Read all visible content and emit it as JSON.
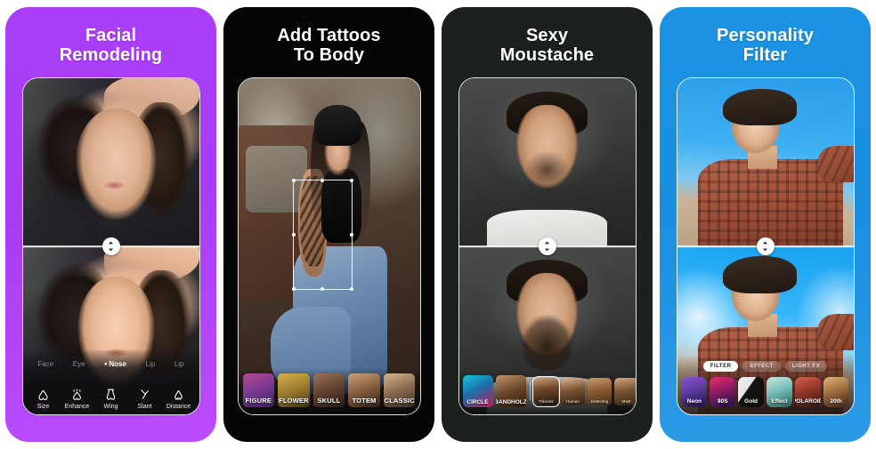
{
  "app_store_gallery": {
    "panels": [
      {
        "id": "facial-remodeling",
        "title": "Facial\nRemodeling",
        "background_color": "#a93cf8",
        "comparison_handle": "vertical-drag-handle",
        "tabs": [
          {
            "label": "Face",
            "selected": false
          },
          {
            "label": "Eye",
            "selected": false
          },
          {
            "label": "Nose",
            "selected": true
          },
          {
            "label": "Lip",
            "selected": false
          },
          {
            "label": "Lip",
            "selected": false
          }
        ],
        "tools": [
          {
            "label": "Size",
            "icon": "nose-size-icon"
          },
          {
            "label": "Enhance",
            "icon": "nose-enhance-icon"
          },
          {
            "label": "Wing",
            "icon": "nose-wing-icon"
          },
          {
            "label": "Slant",
            "icon": "nose-slant-icon"
          },
          {
            "label": "Distance",
            "icon": "nose-distance-icon"
          }
        ]
      },
      {
        "id": "add-tattoos",
        "title": "Add Tattoos\nTo Body",
        "background_color": "#050505",
        "selection_box": "tattoo-placement-box",
        "thumbnails": [
          {
            "label": "FIGURE",
            "colors": [
              "#b44a8e",
              "#5d3f8e"
            ]
          },
          {
            "label": "FLOWER",
            "colors": [
              "#c8a23c",
              "#6a5a22"
            ]
          },
          {
            "label": "SKULL",
            "colors": [
              "#8e6a4e",
              "#3d2a1e"
            ]
          },
          {
            "label": "TOTEM",
            "colors": [
              "#c49a74",
              "#4a3324"
            ]
          },
          {
            "label": "CLASSIC",
            "colors": [
              "#cfae8c",
              "#5a4232"
            ]
          }
        ]
      },
      {
        "id": "sexy-moustache",
        "title": "Sexy\nMoustache",
        "background_color": "#1c2120",
        "comparison_handle": "vertical-drag-handle",
        "thumbnails": [
          {
            "label": "CIRCLE",
            "size": "large",
            "selected": false,
            "colors": [
              "#17c4d8",
              "#c2185b"
            ]
          },
          {
            "label": "BANDHOLZ",
            "size": "large",
            "selected": false,
            "colors": [
              "#b98a5e",
              "#3a2416"
            ]
          },
          {
            "label": "Tolerant",
            "size": "small",
            "selected": true,
            "colors": [
              "#c49a76",
              "#2a1a10"
            ]
          },
          {
            "label": "Human",
            "size": "small",
            "selected": false,
            "colors": [
              "#d2a884",
              "#3a2418"
            ]
          },
          {
            "label": "Detecting",
            "size": "small",
            "selected": false,
            "colors": [
              "#c08a5c",
              "#51311c"
            ]
          },
          {
            "label": "Mast",
            "size": "small",
            "selected": false,
            "colors": [
              "#cfa27c",
              "#402a1a"
            ]
          }
        ]
      },
      {
        "id": "personality-filter",
        "title": "Personality\nFilter",
        "background_color": "#1a8fe0",
        "comparison_handle": "vertical-drag-handle",
        "pills": [
          {
            "label": "FILTER",
            "selected": true
          },
          {
            "label": "EFFECT",
            "selected": false
          },
          {
            "label": "LIGHT FX",
            "selected": false
          }
        ],
        "thumbnails": [
          {
            "label": "Neon",
            "colors": [
              "#6f3fb5",
              "#22134a"
            ]
          },
          {
            "label": "80S",
            "colors": [
              "#e0245e",
              "#1b1440"
            ]
          },
          {
            "label": "Gold",
            "colors": [
              "#f2f2f2",
              "#101010"
            ]
          },
          {
            "label": "Effect",
            "colors": [
              "#76c6c0",
              "#2e5c58"
            ]
          },
          {
            "label": "POLAROID",
            "colors": [
              "#c24a3e",
              "#3c1a16"
            ]
          },
          {
            "label": "20th",
            "colors": [
              "#d6a05e",
              "#4a2a18"
            ]
          }
        ]
      }
    ]
  }
}
